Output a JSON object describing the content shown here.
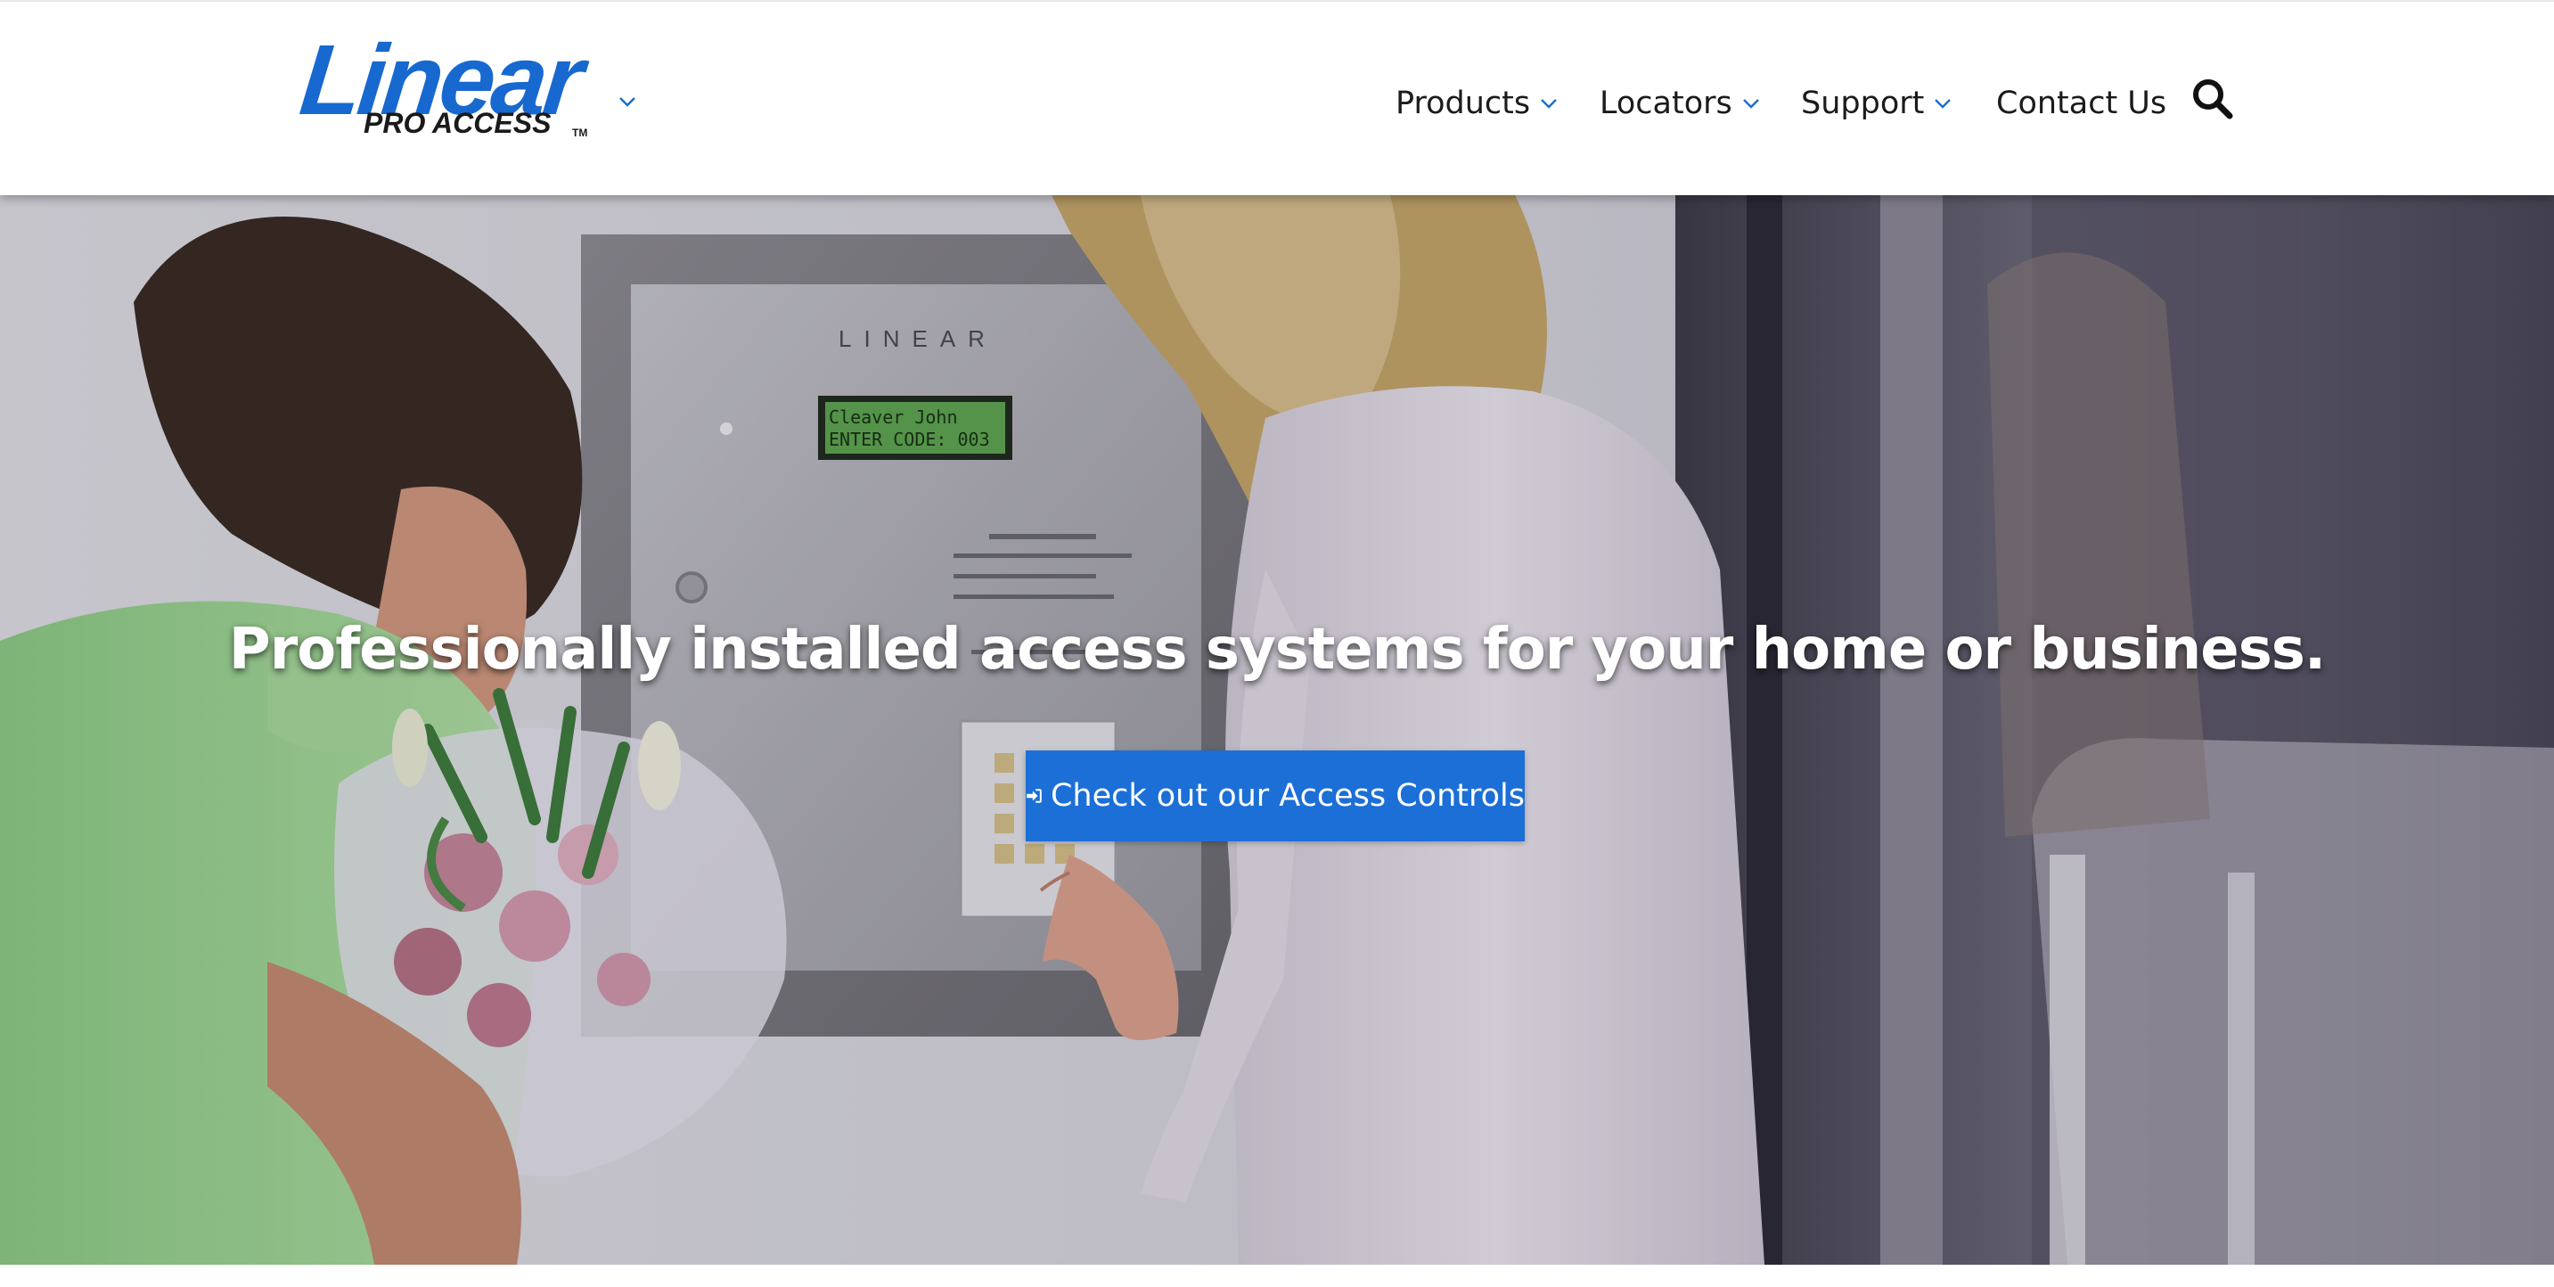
{
  "header": {
    "logo": {
      "wordmark": "Linear",
      "subtitle": "PRO ACCESS",
      "trademark": "TM"
    },
    "nav": [
      {
        "label": "Products",
        "has_dropdown": true
      },
      {
        "label": "Locators",
        "has_dropdown": true
      },
      {
        "label": "Support",
        "has_dropdown": true
      },
      {
        "label": "Contact Us",
        "has_dropdown": false
      }
    ],
    "search_icon": "search-icon"
  },
  "hero": {
    "headline": {
      "part1_bold": "Professionally installed",
      "part2": " access systems for your ",
      "part3_bold": "home",
      "part4": " or ",
      "part5_bold": "business",
      "part6": "."
    },
    "cta": {
      "label": "Check out our Access Controls",
      "icon": "sign-in-icon"
    },
    "panel": {
      "brand": "LINEAR",
      "display_line1": "Cleaver John",
      "display_line2": "ENTER CODE:  003"
    }
  },
  "colors": {
    "brand_blue": "#1769d0",
    "cta_blue": "#1b6fd6",
    "nav_text": "#1b1b1b",
    "chevron_blue": "#1a6fd0"
  }
}
